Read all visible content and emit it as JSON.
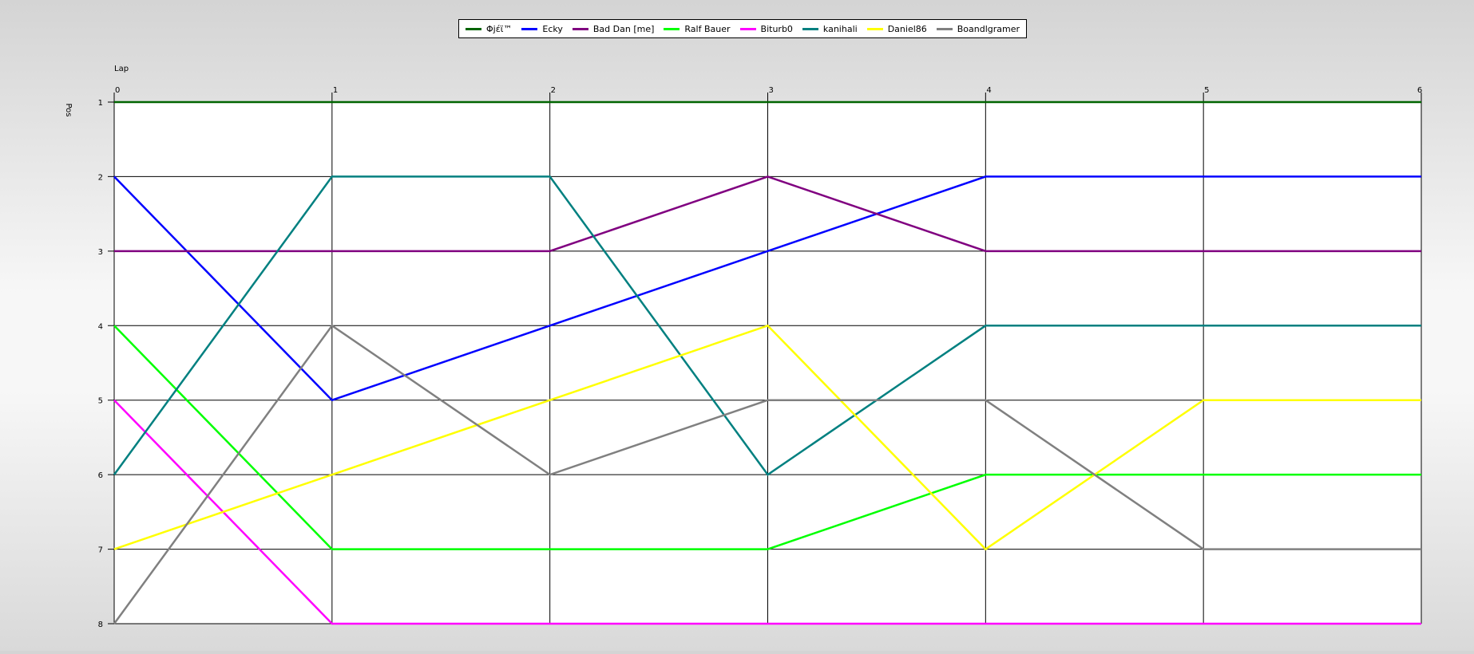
{
  "chart_data": {
    "type": "line",
    "xlabel": "Lap",
    "ylabel": "Pos",
    "x": [
      0,
      1,
      2,
      3,
      4,
      5,
      6
    ],
    "xlim": [
      0,
      6
    ],
    "ylim": [
      1,
      8
    ],
    "y_inverted": true,
    "y_ticks": [
      1,
      2,
      3,
      4,
      5,
      6,
      7,
      8
    ],
    "grid": true,
    "legend_position": "top-center",
    "series": [
      {
        "name": "Φjέϊ™",
        "color": "#006400",
        "values": [
          1,
          1,
          1,
          1,
          1,
          1,
          1
        ]
      },
      {
        "name": "Ecky",
        "color": "#0000ff",
        "values": [
          2,
          5,
          4,
          3,
          2,
          2,
          2
        ]
      },
      {
        "name": "Bad Dan [me]",
        "color": "#800080",
        "values": [
          3,
          3,
          3,
          2,
          3,
          3,
          3
        ]
      },
      {
        "name": "Ralf Bauer",
        "color": "#00ff00",
        "values": [
          4,
          7,
          7,
          7,
          6,
          6,
          6
        ]
      },
      {
        "name": "Biturb0",
        "color": "#ff00ff",
        "values": [
          5,
          8,
          8,
          8,
          8,
          8,
          8
        ]
      },
      {
        "name": "kanihali",
        "color": "#008080",
        "values": [
          6,
          2,
          2,
          6,
          4,
          4,
          4
        ]
      },
      {
        "name": "Daniel86",
        "color": "#ffff00",
        "values": [
          7,
          6,
          5,
          4,
          7,
          5,
          5
        ]
      },
      {
        "name": "Boandlgramer",
        "color": "#808080",
        "values": [
          8,
          4,
          6,
          5,
          5,
          7,
          7
        ]
      }
    ]
  }
}
